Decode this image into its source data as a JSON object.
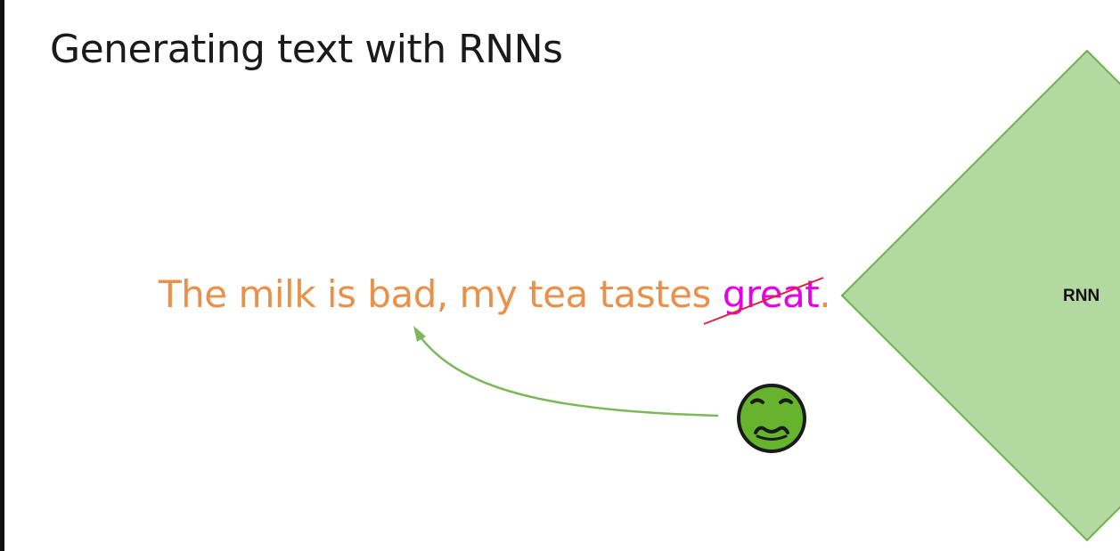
{
  "title": "Generating text with RNNs",
  "sentence": {
    "prefix": "The milk is bad, my tea tastes ",
    "struck_word": "great",
    "suffix": "."
  },
  "diagram": {
    "block_label": "RNN",
    "emoji": "nauseated-face-icon"
  },
  "colors": {
    "sentence_text": "#e8914a",
    "struck_word": "#e600e6",
    "strike_line": "#e0203a",
    "arrow": "#7cb85a",
    "rnn_fill": "#b3d9a0",
    "rnn_stroke": "#6ab04c",
    "emoji_face": "#66b32e"
  }
}
